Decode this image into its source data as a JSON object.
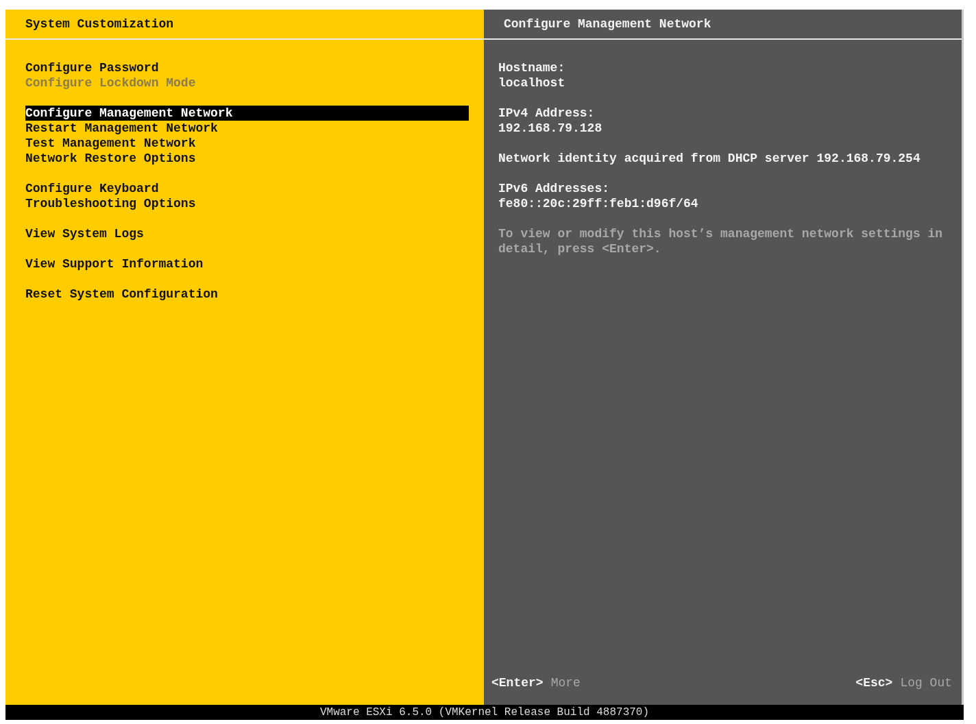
{
  "left_panel": {
    "title": "System Customization",
    "groups": [
      [
        {
          "label": "Configure Password",
          "selected": false,
          "disabled": false
        },
        {
          "label": "Configure Lockdown Mode",
          "selected": false,
          "disabled": true
        }
      ],
      [
        {
          "label": "Configure Management Network",
          "selected": true,
          "disabled": false
        },
        {
          "label": "Restart Management Network",
          "selected": false,
          "disabled": false
        },
        {
          "label": "Test Management Network",
          "selected": false,
          "disabled": false
        },
        {
          "label": "Network Restore Options",
          "selected": false,
          "disabled": false
        }
      ],
      [
        {
          "label": "Configure Keyboard",
          "selected": false,
          "disabled": false
        },
        {
          "label": "Troubleshooting Options",
          "selected": false,
          "disabled": false
        }
      ],
      [
        {
          "label": "View System Logs",
          "selected": false,
          "disabled": false
        }
      ],
      [
        {
          "label": "View Support Information",
          "selected": false,
          "disabled": false
        }
      ],
      [
        {
          "label": "Reset System Configuration",
          "selected": false,
          "disabled": false
        }
      ]
    ]
  },
  "right_panel": {
    "title": "Configure Management Network",
    "sections": [
      {
        "kind": "field",
        "label": "Hostname:",
        "value": "localhost"
      },
      {
        "kind": "field",
        "label": "IPv4 Address:",
        "value": "192.168.79.128"
      },
      {
        "kind": "note",
        "text": "Network identity acquired from DHCP server 192.168.79.254"
      },
      {
        "kind": "field",
        "label": "IPv6 Addresses:",
        "value": "fe80::20c:29ff:feb1:d96f/64"
      },
      {
        "kind": "hint",
        "text": "To view or modify this host’s management network settings in detail, press <Enter>."
      }
    ],
    "footer": [
      {
        "key": "<Enter>",
        "action": "More"
      },
      {
        "key": "<Esc>",
        "action": "Log Out"
      }
    ]
  },
  "status_bar": "VMware ESXi 6.5.0 (VMKernel Release Build 4887370)"
}
